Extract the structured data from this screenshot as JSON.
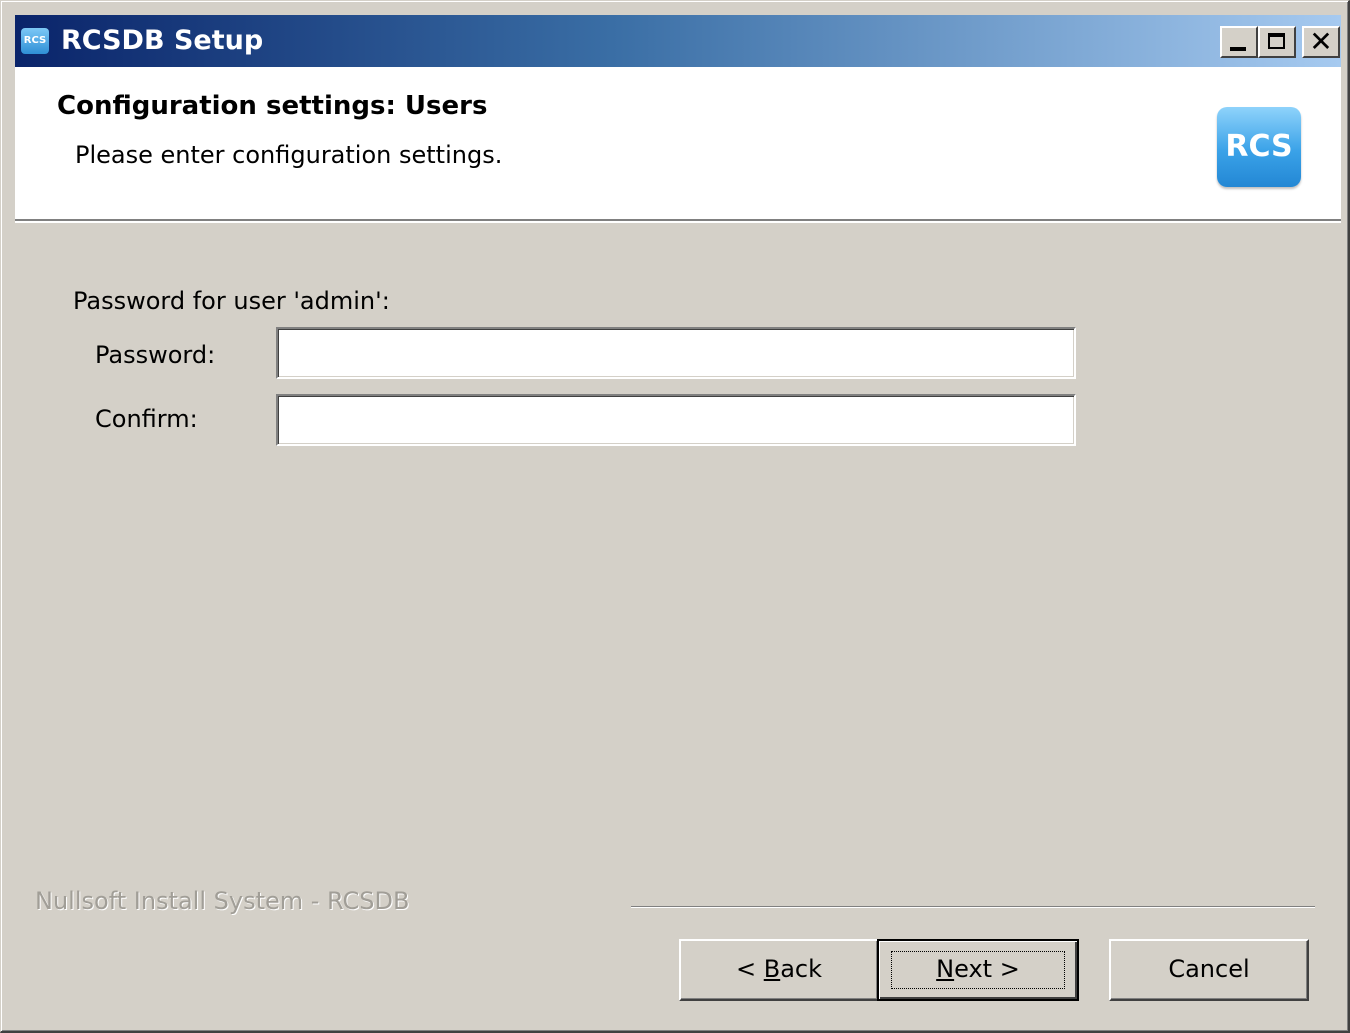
{
  "window": {
    "title": "RCSDB Setup",
    "app_icon_text": "RCS"
  },
  "header": {
    "title": "Configuration settings: Users",
    "subtitle": "Please enter configuration settings.",
    "logo_text": "RCS"
  },
  "form": {
    "group_label": "Password for user 'admin':",
    "password_label": "Password:",
    "password_value": "",
    "confirm_label": "Confirm:",
    "confirm_value": ""
  },
  "footer": {
    "branding": "Nullsoft Install System - RCSDB",
    "back": {
      "prefix": "< ",
      "mnemonic": "B",
      "rest": "ack"
    },
    "next": {
      "prefix": "",
      "mnemonic": "N",
      "rest": "ext >"
    },
    "cancel": "Cancel"
  },
  "titlebar_buttons": {
    "close_glyph": "✕"
  }
}
